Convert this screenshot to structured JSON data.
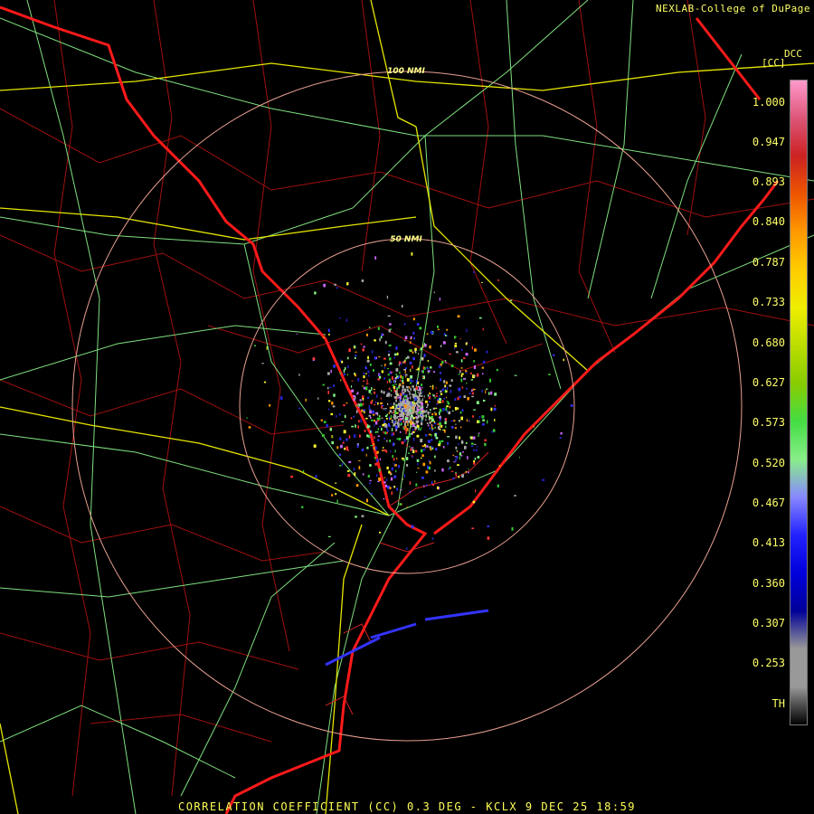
{
  "credit": "NEXLAB-College of DuPage",
  "footer": "CORRELATION COEFFICIENT (CC) 0.3 DEG - KCLX 9 DEC 25 18:59",
  "scale": {
    "product": "DCC",
    "unit": "[CC]",
    "ticks": [
      "1.000",
      "0.947",
      "0.893",
      "0.840",
      "0.787",
      "0.733",
      "0.680",
      "0.627",
      "0.573",
      "0.520",
      "0.467",
      "0.413",
      "0.360",
      "0.307",
      "0.253",
      "TH"
    ]
  },
  "range_rings": [
    "100 NMI",
    "50 NMI"
  ],
  "colors": {
    "state_border": "#ff1a1a",
    "county_lines": "#a01010",
    "highways": "#7fe07f",
    "interstates": "#e6e600",
    "range_ring": "#e8a090",
    "text": "#ffff66"
  },
  "colorbar_stops": [
    "#ff99cc",
    "#dd5577",
    "#cc2222",
    "#ee5500",
    "#ff9900",
    "#ffcc00",
    "#eeee00",
    "#bbdd00",
    "#88cc00",
    "#44dd44",
    "#88ee88",
    "#8888ff",
    "#2222ff",
    "#0000dd",
    "#000099",
    "#999999",
    "#999999",
    "#000000"
  ]
}
